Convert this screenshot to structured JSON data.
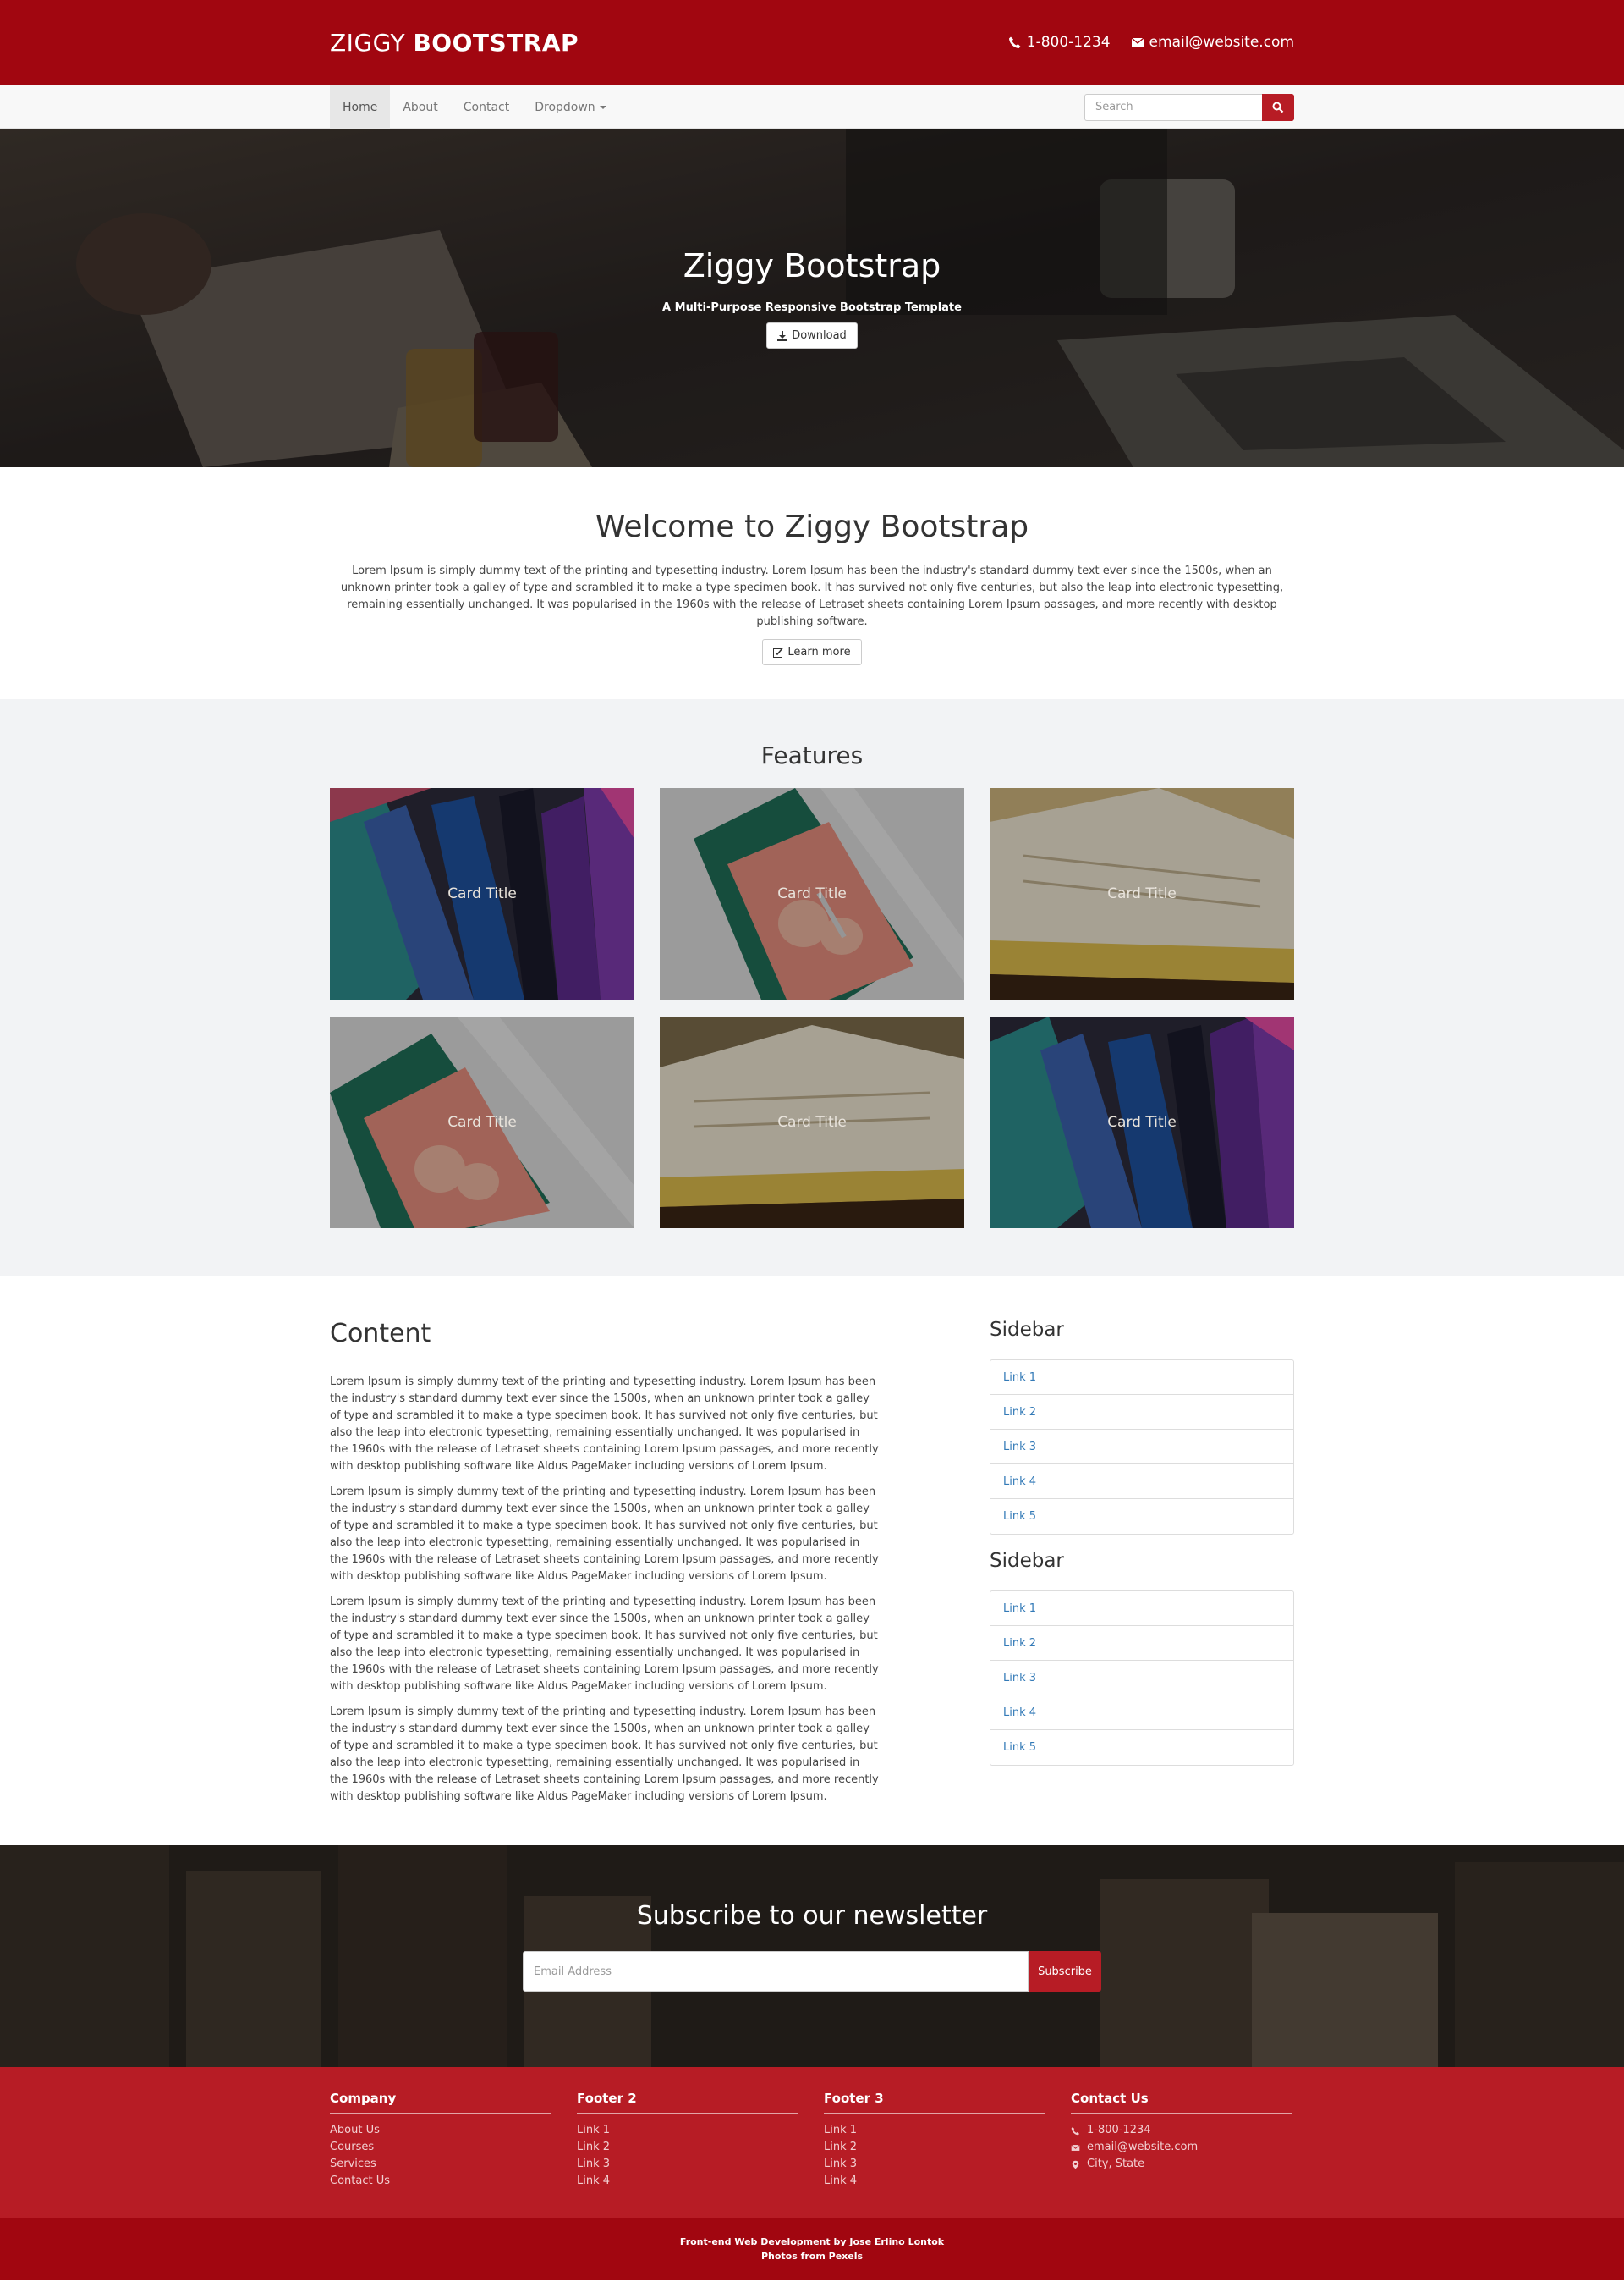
{
  "header": {
    "brand_light": "ZIGGY",
    "brand_bold": "BOOTSTRAP",
    "phone": "1-800-1234",
    "email": "email@website.com"
  },
  "nav": {
    "items": [
      {
        "label": "Home",
        "active": true
      },
      {
        "label": "About"
      },
      {
        "label": "Contact"
      },
      {
        "label": "Dropdown"
      }
    ],
    "search_placeholder": "Search"
  },
  "hero": {
    "title": "Ziggy Bootstrap",
    "tagline": "A Multi-Purpose Responsive Bootstrap Template",
    "button": "Download"
  },
  "welcome": {
    "title": "Welcome to Ziggy Bootstrap",
    "text": "Lorem Ipsum is simply dummy text of the printing and typesetting industry. Lorem Ipsum has been the industry's standard dummy text ever since the 1500s, when an unknown printer took a galley of type and scrambled it to make a type specimen book. It has survived not only five centuries, but also the leap into electronic typesetting, remaining essentially unchanged. It was popularised in the 1960s with the release of Letraset sheets containing Lorem Ipsum passages, and more recently with desktop publishing software.",
    "button": "Learn more"
  },
  "features": {
    "title": "Features",
    "cards": [
      {
        "title": "Card Title",
        "image": "pencils"
      },
      {
        "title": "Card Title",
        "image": "cutting-mat"
      },
      {
        "title": "Card Title",
        "image": "open-book"
      },
      {
        "title": "Card Title",
        "image": "cutting-mat"
      },
      {
        "title": "Card Title",
        "image": "open-book"
      },
      {
        "title": "Card Title",
        "image": "pencils"
      }
    ]
  },
  "content": {
    "title": "Content",
    "paragraphs": [
      "Lorem Ipsum is simply dummy text of the printing and typesetting industry. Lorem Ipsum has been the industry's standard dummy text ever since the 1500s, when an unknown printer took a galley of type and scrambled it to make a type specimen book. It has survived not only five centuries, but also the leap into electronic typesetting, remaining essentially unchanged. It was popularised in the 1960s with the release of Letraset sheets containing Lorem Ipsum passages, and more recently with desktop publishing software like Aldus PageMaker including versions of Lorem Ipsum.",
      "Lorem Ipsum is simply dummy text of the printing and typesetting industry. Lorem Ipsum has been the industry's standard dummy text ever since the 1500s, when an unknown printer took a galley of type and scrambled it to make a type specimen book. It has survived not only five centuries, but also the leap into electronic typesetting, remaining essentially unchanged. It was popularised in the 1960s with the release of Letraset sheets containing Lorem Ipsum passages, and more recently with desktop publishing software like Aldus PageMaker including versions of Lorem Ipsum.",
      "Lorem Ipsum is simply dummy text of the printing and typesetting industry. Lorem Ipsum has been the industry's standard dummy text ever since the 1500s, when an unknown printer took a galley of type and scrambled it to make a type specimen book. It has survived not only five centuries, but also the leap into electronic typesetting, remaining essentially unchanged. It was popularised in the 1960s with the release of Letraset sheets containing Lorem Ipsum passages, and more recently with desktop publishing software like Aldus PageMaker including versions of Lorem Ipsum.",
      "Lorem Ipsum is simply dummy text of the printing and typesetting industry. Lorem Ipsum has been the industry's standard dummy text ever since the 1500s, when an unknown printer took a galley of type and scrambled it to make a type specimen book. It has survived not only five centuries, but also the leap into electronic typesetting, remaining essentially unchanged. It was popularised in the 1960s with the release of Letraset sheets containing Lorem Ipsum passages, and more recently with desktop publishing software like Aldus PageMaker including versions of Lorem Ipsum."
    ]
  },
  "sidebars": [
    {
      "title": "Sidebar",
      "links": [
        "Link 1",
        "Link 2",
        "Link 3",
        "Link 4",
        "Link 5"
      ]
    },
    {
      "title": "Sidebar",
      "links": [
        "Link 1",
        "Link 2",
        "Link 3",
        "Link 4",
        "Link 5"
      ]
    }
  ],
  "newsletter": {
    "title": "Subscribe to our newsletter",
    "placeholder": "Email Address",
    "button": "Subscribe"
  },
  "footer": {
    "columns": [
      {
        "title": "Company",
        "links": [
          "About Us",
          "Courses",
          "Services",
          "Contact Us"
        ]
      },
      {
        "title": "Footer 2",
        "links": [
          "Link 1",
          "Link 2",
          "Link 3",
          "Link 4"
        ]
      },
      {
        "title": "Footer 3",
        "links": [
          "Link 1",
          "Link 2",
          "Link 3",
          "Link 4"
        ]
      }
    ],
    "contact": {
      "title": "Contact Us",
      "items": [
        {
          "icon": "phone-icon",
          "text": "1-800-1234"
        },
        {
          "icon": "envelope-icon",
          "text": "email@website.com"
        },
        {
          "icon": "map-marker-icon",
          "text": "City, State"
        }
      ]
    },
    "credit": "Front-end Web Development by Jose Erlino Lontok",
    "photos": "Photos from Pexels"
  },
  "colors": {
    "primary_dark": "#a10610",
    "primary": "#b71c25",
    "link": "#337ab7",
    "features_bg": "#f2f3f5"
  }
}
